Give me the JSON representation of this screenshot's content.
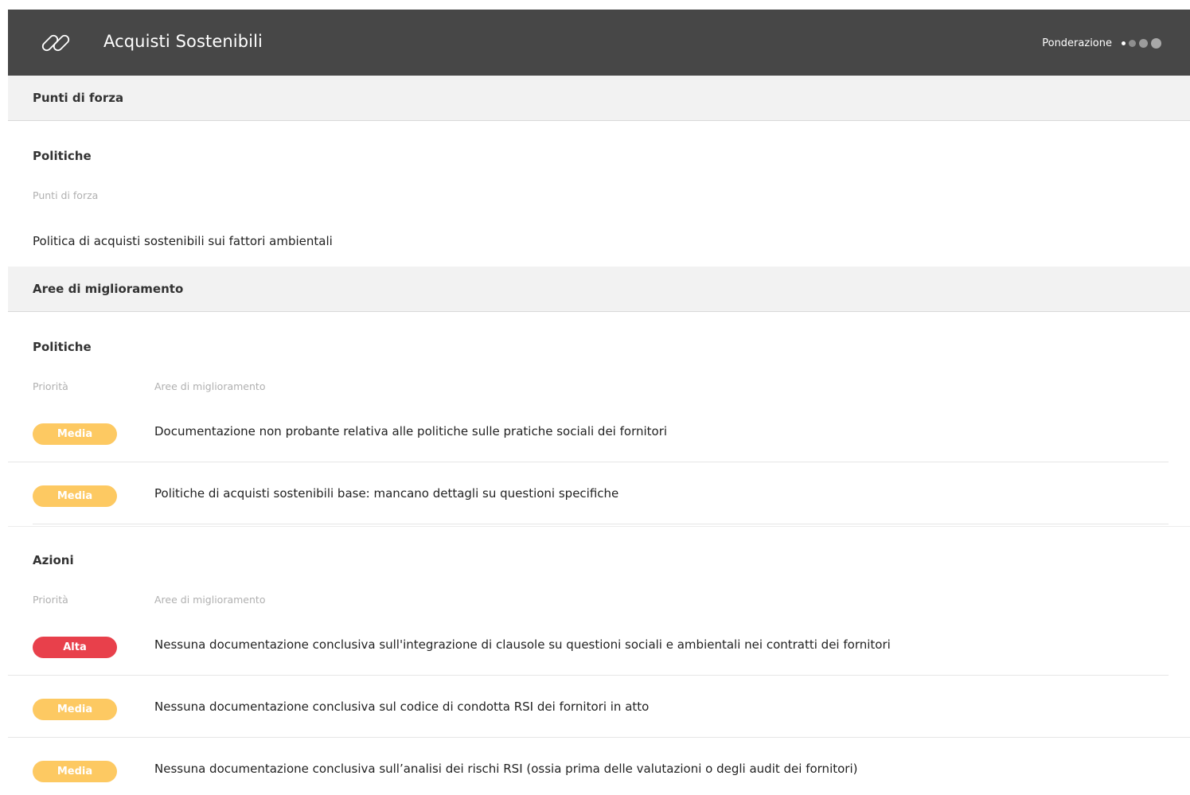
{
  "header": {
    "title": "Acquisti Sostenibili",
    "weight_label": "Ponderazione",
    "icon": "link-icon",
    "background": "#474747"
  },
  "strengths": {
    "band_label": "Punti di forza",
    "group_title": "Politiche",
    "column_header": "Punti di forza",
    "items": [
      "Politica di acquisti sostenibili sui fattori ambientali"
    ]
  },
  "improvements": {
    "band_label": "Aree di miglioramento",
    "groups": [
      {
        "title": "Politiche",
        "col_priority": "Priorità",
        "col_area": "Aree di miglioramento",
        "items": [
          {
            "priority": "Media",
            "text": "Documentazione non probante relativa alle politiche sulle pratiche sociali dei fornitori"
          },
          {
            "priority": "Media",
            "text": "Politiche di acquisti sostenibili base: mancano dettagli su questioni specifiche"
          }
        ]
      },
      {
        "title": "Azioni",
        "col_priority": "Priorità",
        "col_area": "Aree di miglioramento",
        "items": [
          {
            "priority": "Alta",
            "text": "Nessuna documentazione conclusiva sull'integrazione di clausole su questioni sociali e ambientali nei contratti dei fornitori"
          },
          {
            "priority": "Media",
            "text": "Nessuna documentazione conclusiva sul codice di condotta RSI dei fornitori in atto"
          },
          {
            "priority": "Media",
            "text": "Nessuna documentazione conclusiva sull’analisi dei rischi RSI (ossia prima delle valutazioni o degli audit dei fornitori)"
          }
        ]
      }
    ]
  },
  "colors": {
    "media": "#fdc962",
    "alta": "#e8404b"
  }
}
